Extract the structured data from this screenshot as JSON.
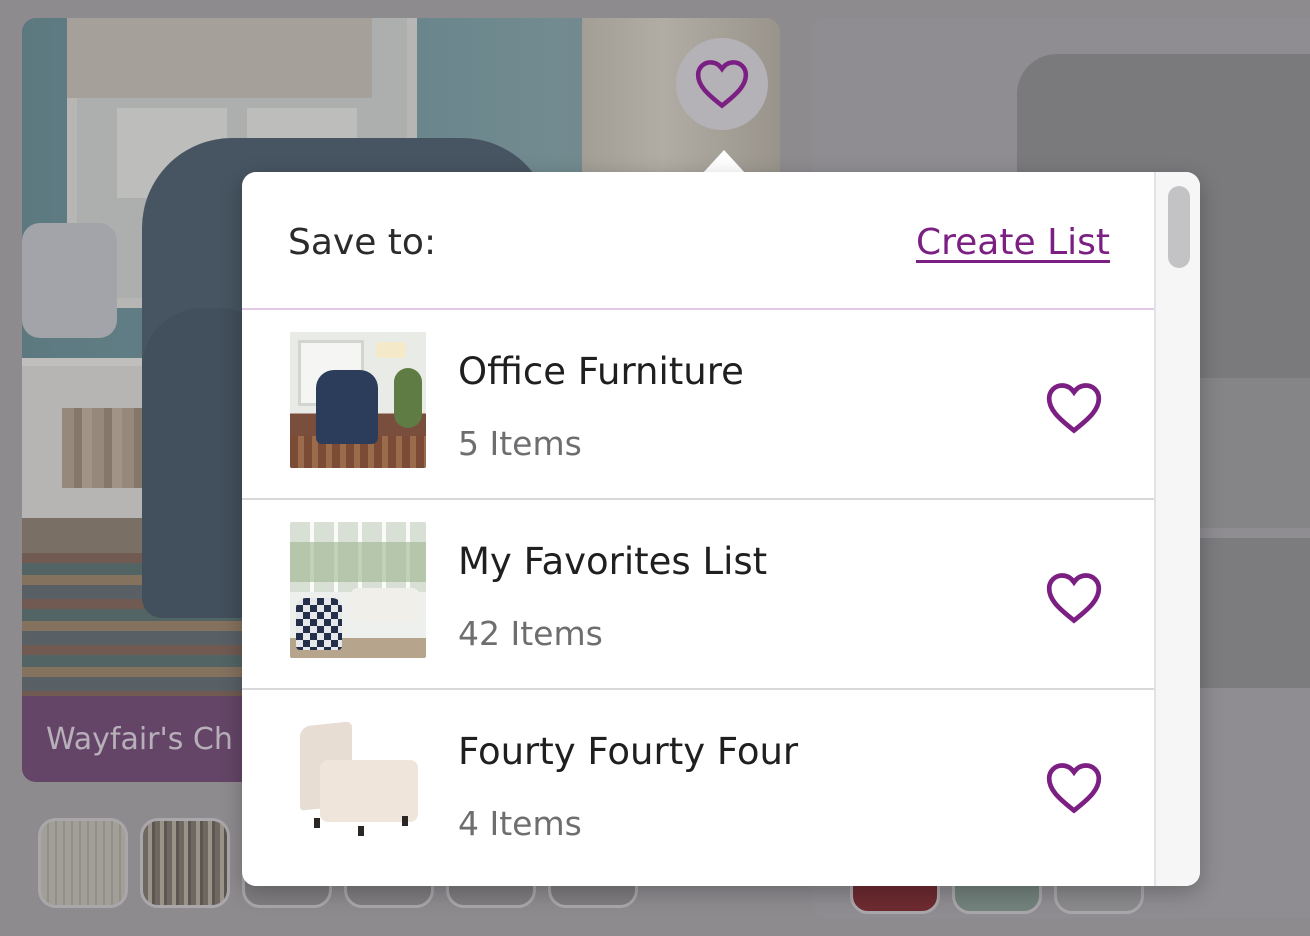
{
  "product_card": {
    "banner_text": "Wayfair's Ch"
  },
  "popover": {
    "title": "Save to:",
    "create_list_label": "Create List",
    "lists": [
      {
        "name": "Office Furniture",
        "count": "5 Items",
        "icon": "heart-outline-icon"
      },
      {
        "name": "My Favorites List",
        "count": "42 Items",
        "icon": "heart-outline-icon"
      },
      {
        "name": "Fourty Fourty Four",
        "count": "4 Items",
        "icon": "heart-outline-icon"
      }
    ]
  },
  "colors": {
    "accent_purple": "#7b1f82",
    "banner_purple": "#5a2a5c",
    "divider_lavender": "#e2c9e6"
  }
}
